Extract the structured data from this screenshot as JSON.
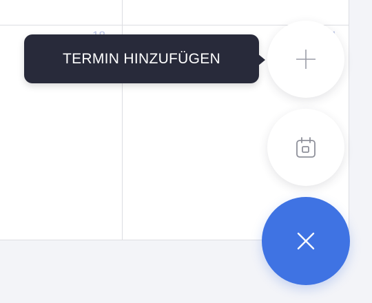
{
  "calendar": {
    "day_a": "18",
    "day_b": "1"
  },
  "tooltip": {
    "label": "TERMIN HINZUFÜGEN"
  },
  "fabs": {
    "add_icon": "plus-icon",
    "calendar_icon": "calendar-icon",
    "close_icon": "close-icon"
  },
  "colors": {
    "accent": "#3f73e3",
    "tooltip_bg": "#282a3a",
    "day_number": "#b9c3e6"
  }
}
